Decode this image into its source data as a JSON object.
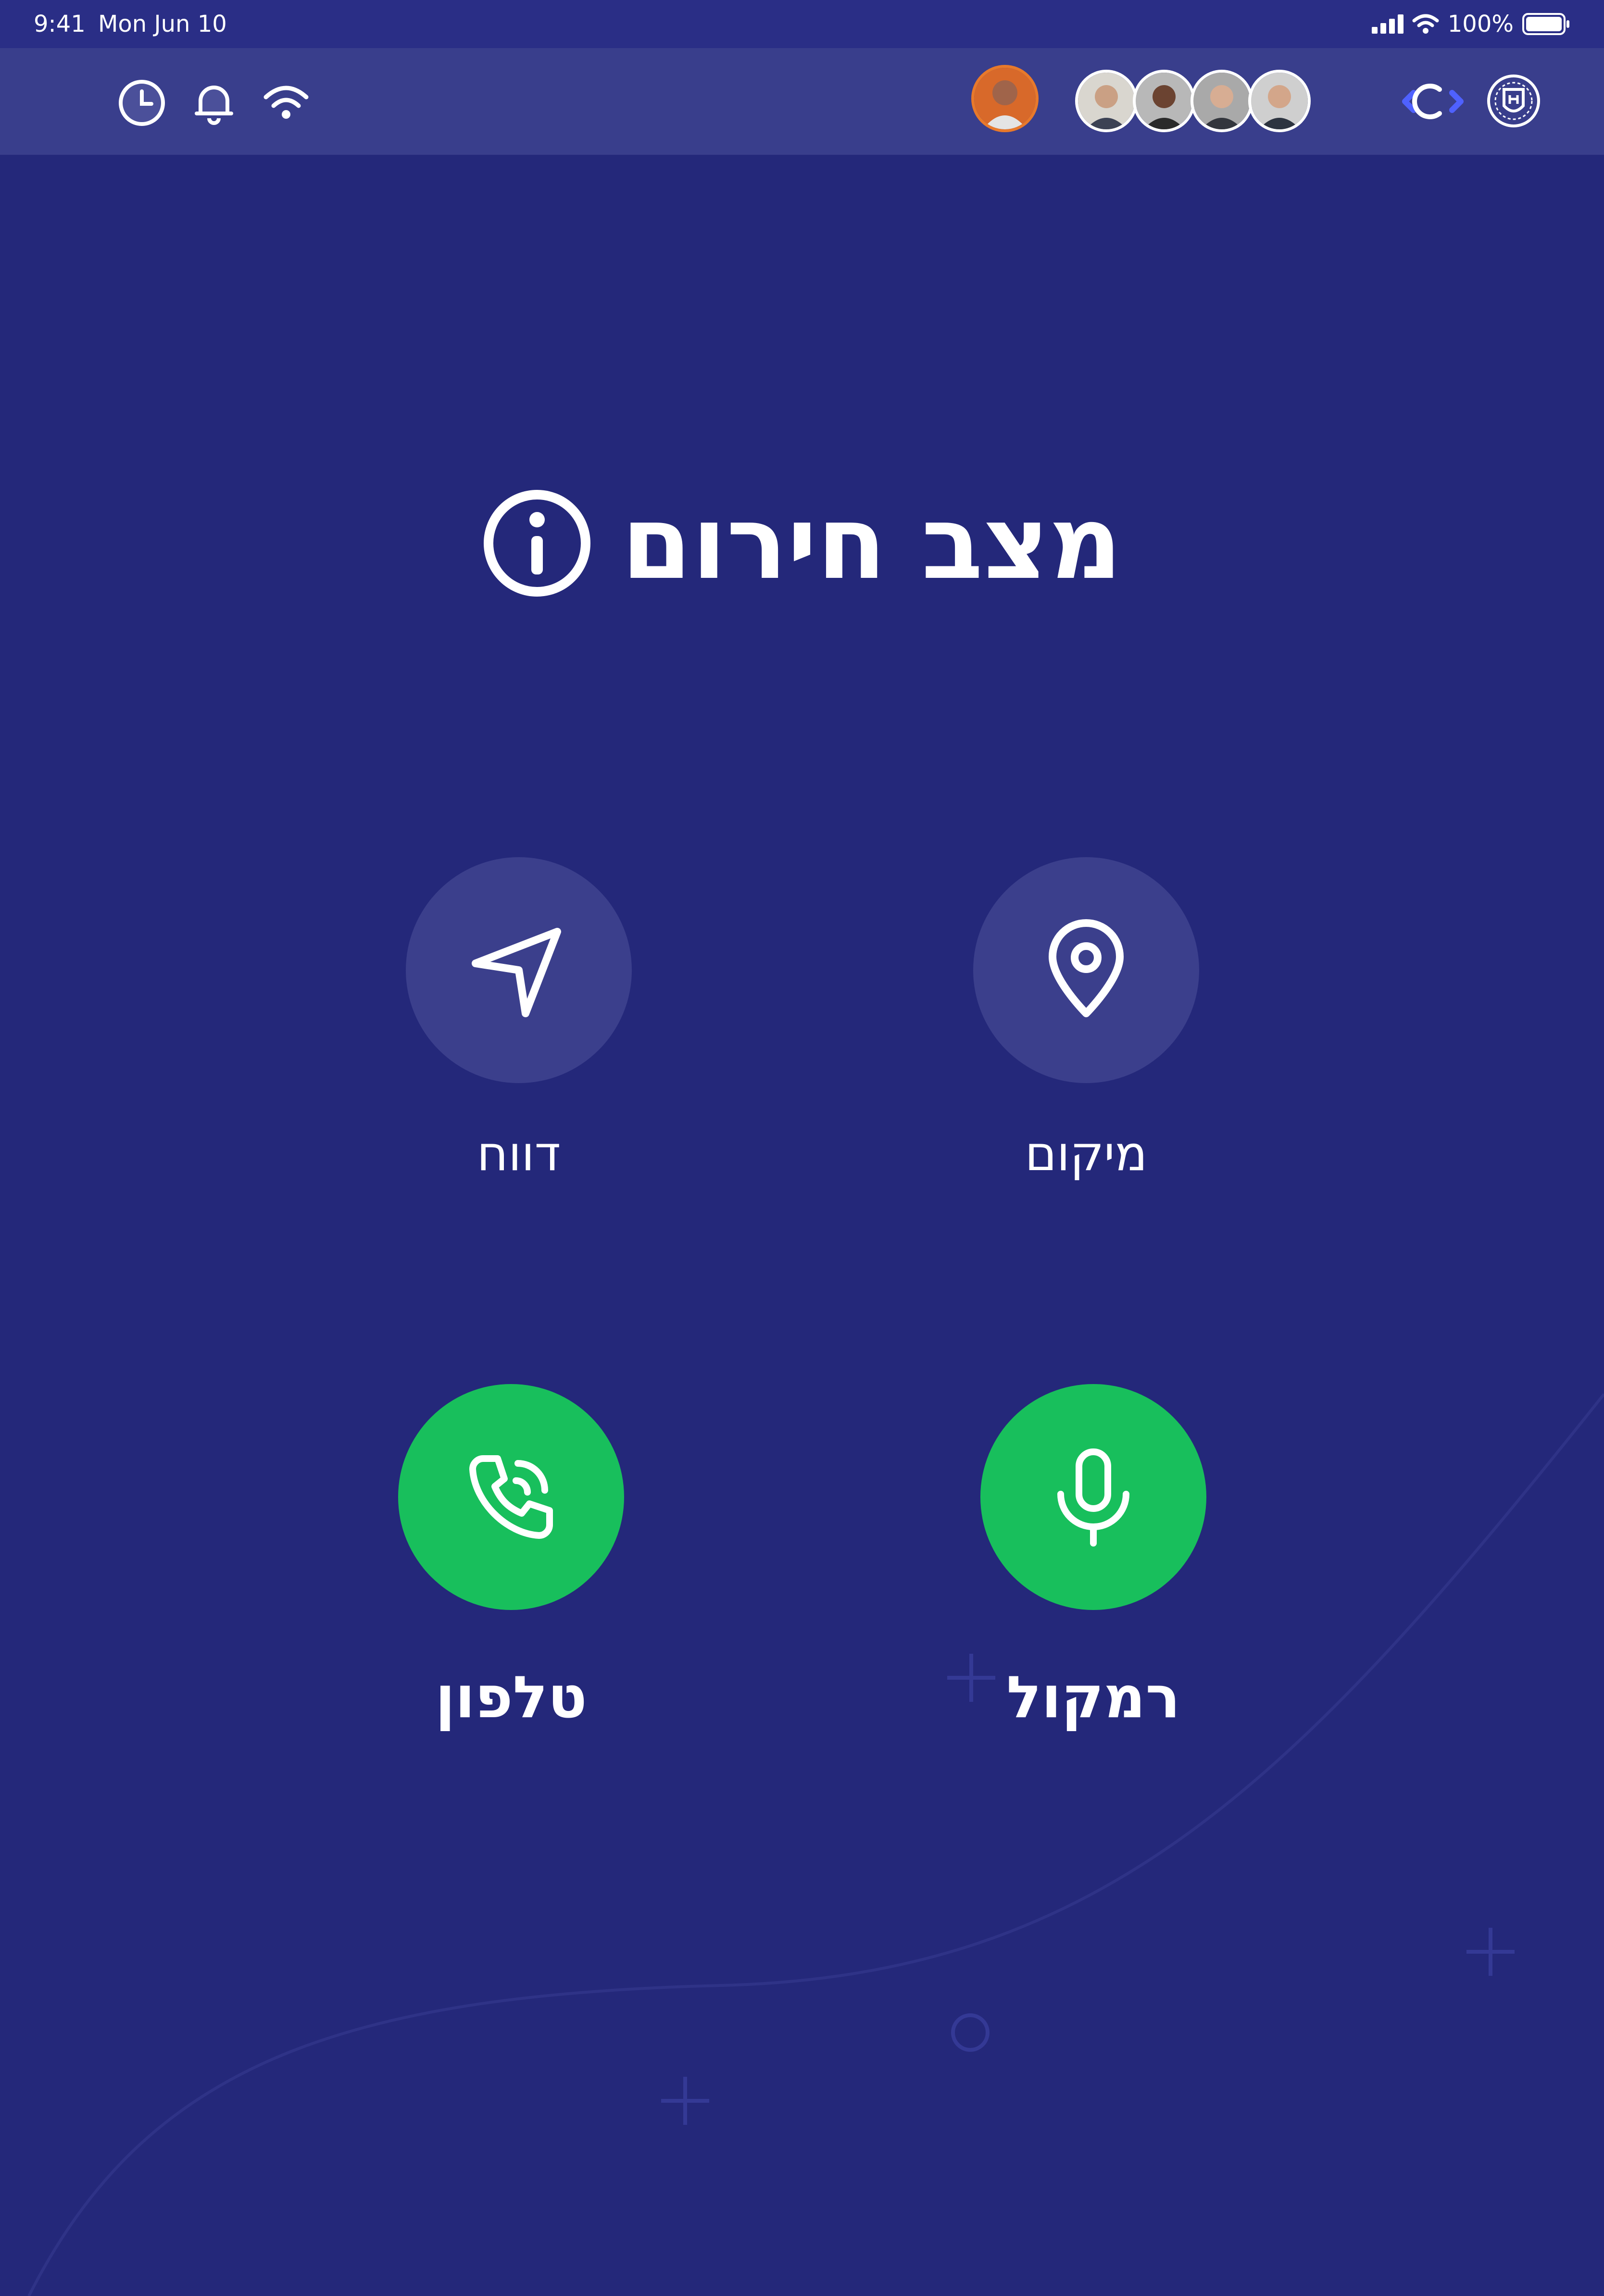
{
  "status_bar": {
    "time": "9:41",
    "date": "Mon Jun 10",
    "battery": "100%"
  },
  "toolbar": {
    "left_icons": [
      "clock-icon",
      "bell-icon",
      "wifi-icon"
    ],
    "avatars": [
      "avatar-main",
      "avatar-1",
      "avatar-2",
      "avatar-3",
      "avatar-4"
    ],
    "right_icons": [
      "sync-icon",
      "emblem-logo"
    ]
  },
  "main": {
    "title": "מצב חירום"
  },
  "actions": {
    "report": {
      "label": "דווח",
      "icon": "send-icon"
    },
    "location": {
      "label": "מיקום",
      "icon": "map-pin-icon"
    },
    "phone": {
      "label": "טלפון",
      "icon": "phone-call-icon"
    },
    "speaker": {
      "label": "רמקול",
      "icon": "microphone-icon"
    }
  },
  "colors": {
    "background": "#24287a",
    "toolbar": "#393e8c",
    "action_gray": "#3b3f8c",
    "action_green": "#18bf5c"
  }
}
